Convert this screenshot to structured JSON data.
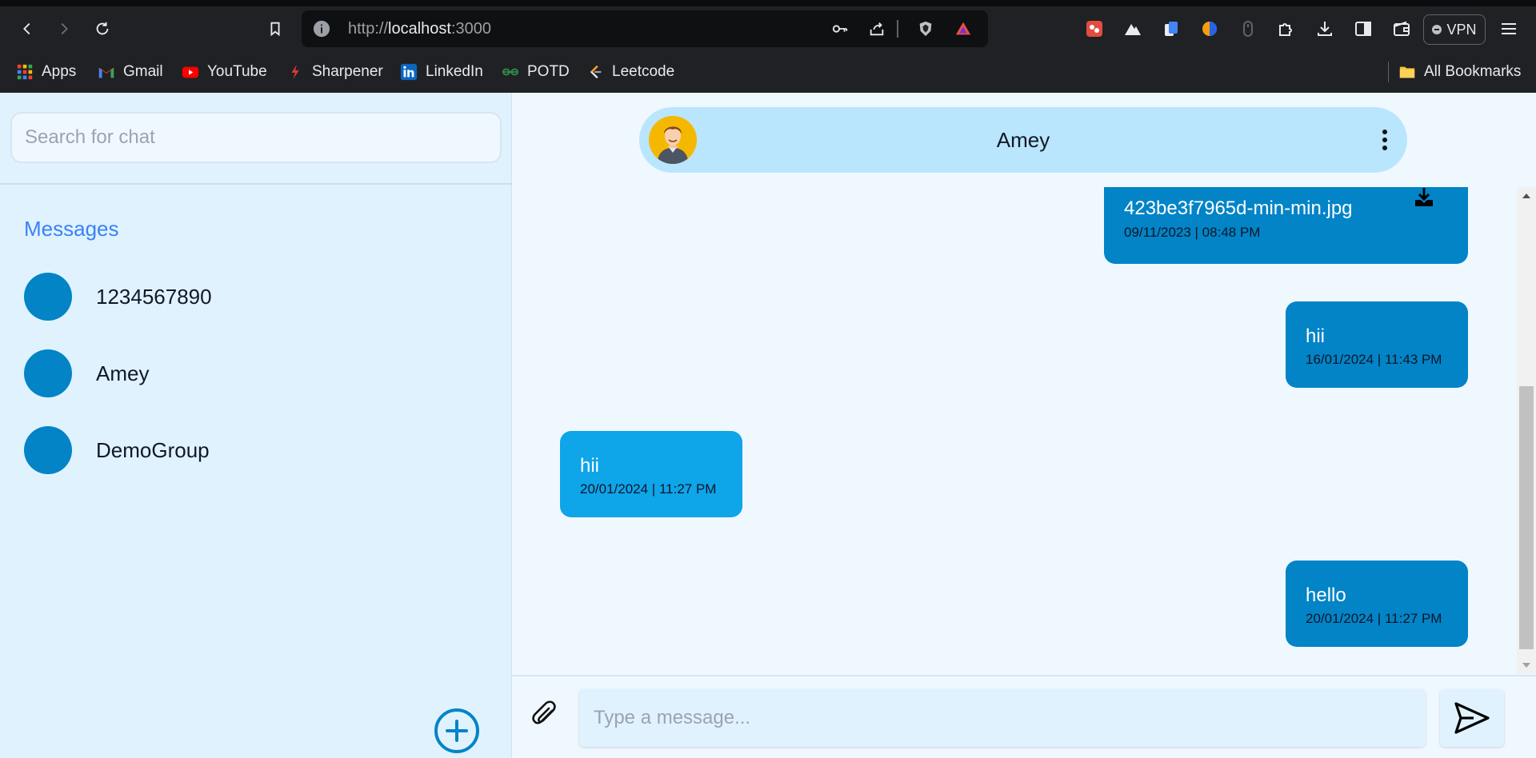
{
  "browser": {
    "url_scheme": "http://",
    "url_host": "localhost",
    "url_port": ":3000",
    "vpn_label": "VPN",
    "bookmarks": [
      {
        "label": "Apps",
        "icon": "apps-grid-icon"
      },
      {
        "label": "Gmail",
        "icon": "gmail-icon"
      },
      {
        "label": "YouTube",
        "icon": "youtube-icon"
      },
      {
        "label": "Sharpener",
        "icon": "sharpener-icon"
      },
      {
        "label": "LinkedIn",
        "icon": "linkedin-icon"
      },
      {
        "label": "POTD",
        "icon": "gfg-icon"
      },
      {
        "label": "Leetcode",
        "icon": "leetcode-icon"
      }
    ],
    "all_bookmarks_label": "All Bookmarks"
  },
  "sidebar": {
    "search_placeholder": "Search for chat",
    "messages_title": "Messages",
    "chats": [
      {
        "name": "1234567890"
      },
      {
        "name": "Amey"
      },
      {
        "name": "DemoGroup"
      }
    ]
  },
  "chat": {
    "contact_name": "Amey",
    "messages": [
      {
        "direction": "out",
        "text": "423be3f7965d-min-min.jpg",
        "time": "09/11/2023 | 08:48 PM",
        "attachment": true
      },
      {
        "direction": "out",
        "text": "hii",
        "time": "16/01/2024 | 11:43 PM"
      },
      {
        "direction": "in",
        "text": "hii",
        "time": "20/01/2024 | 11:27 PM"
      },
      {
        "direction": "out",
        "text": "hello",
        "time": "20/01/2024 | 11:27 PM"
      }
    ],
    "input_placeholder": "Type a message..."
  },
  "colors": {
    "sidebar_bg": "#e0f2fe",
    "main_bg": "#f0f8ff",
    "outgoing_bubble": "#0284c7",
    "incoming_bubble": "#0ea5e9",
    "header_bg": "#bae6fd",
    "accent_text": "#3b82f6"
  }
}
